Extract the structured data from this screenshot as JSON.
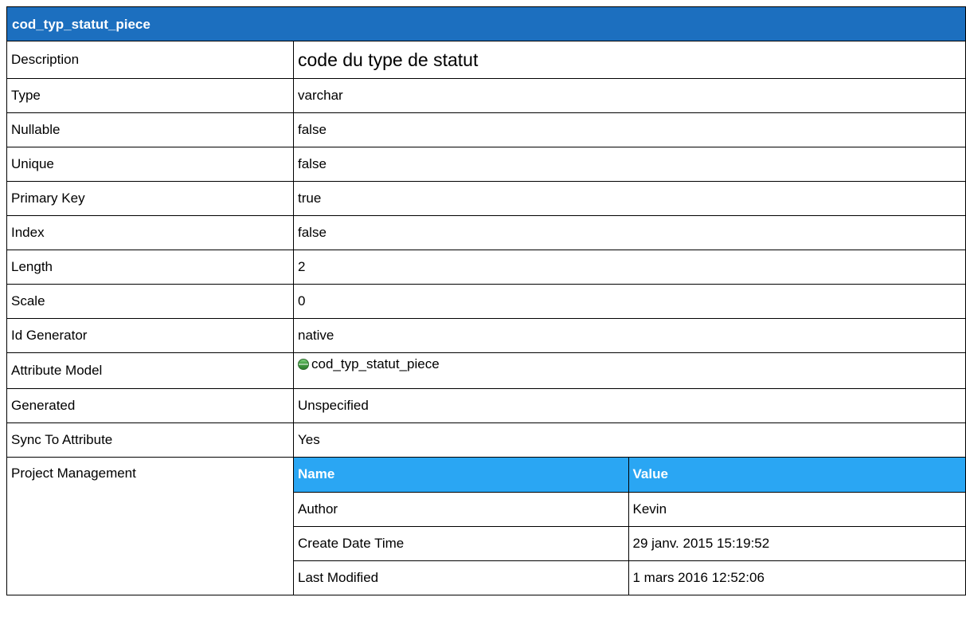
{
  "title": "cod_typ_statut_piece",
  "properties": [
    {
      "key": "Description",
      "value": "code du type de statut"
    },
    {
      "key": "Type",
      "value": "varchar"
    },
    {
      "key": "Nullable",
      "value": "false"
    },
    {
      "key": "Unique",
      "value": "false"
    },
    {
      "key": "Primary Key",
      "value": "true"
    },
    {
      "key": "Index",
      "value": "false"
    },
    {
      "key": "Length",
      "value": "2"
    },
    {
      "key": "Scale",
      "value": "0"
    },
    {
      "key": "Id Generator",
      "value": "native"
    },
    {
      "key": "Attribute Model",
      "value": "cod_typ_statut_piece",
      "icon": "attribute-icon"
    },
    {
      "key": "Generated",
      "value": "Unspecified"
    },
    {
      "key": "Sync To Attribute",
      "value": "Yes"
    }
  ],
  "project_management": {
    "label": "Project Management",
    "headers": {
      "name": "Name",
      "value": "Value"
    },
    "rows": [
      {
        "name": "Author",
        "value": "Kevin"
      },
      {
        "name": "Create Date Time",
        "value": "29 janv. 2015 15:19:52"
      },
      {
        "name": "Last Modified",
        "value": "1 mars 2016 12:52:06"
      }
    ]
  },
  "colors": {
    "title_bar": "#1c6fbf",
    "subtable_header": "#2aa6f3"
  }
}
